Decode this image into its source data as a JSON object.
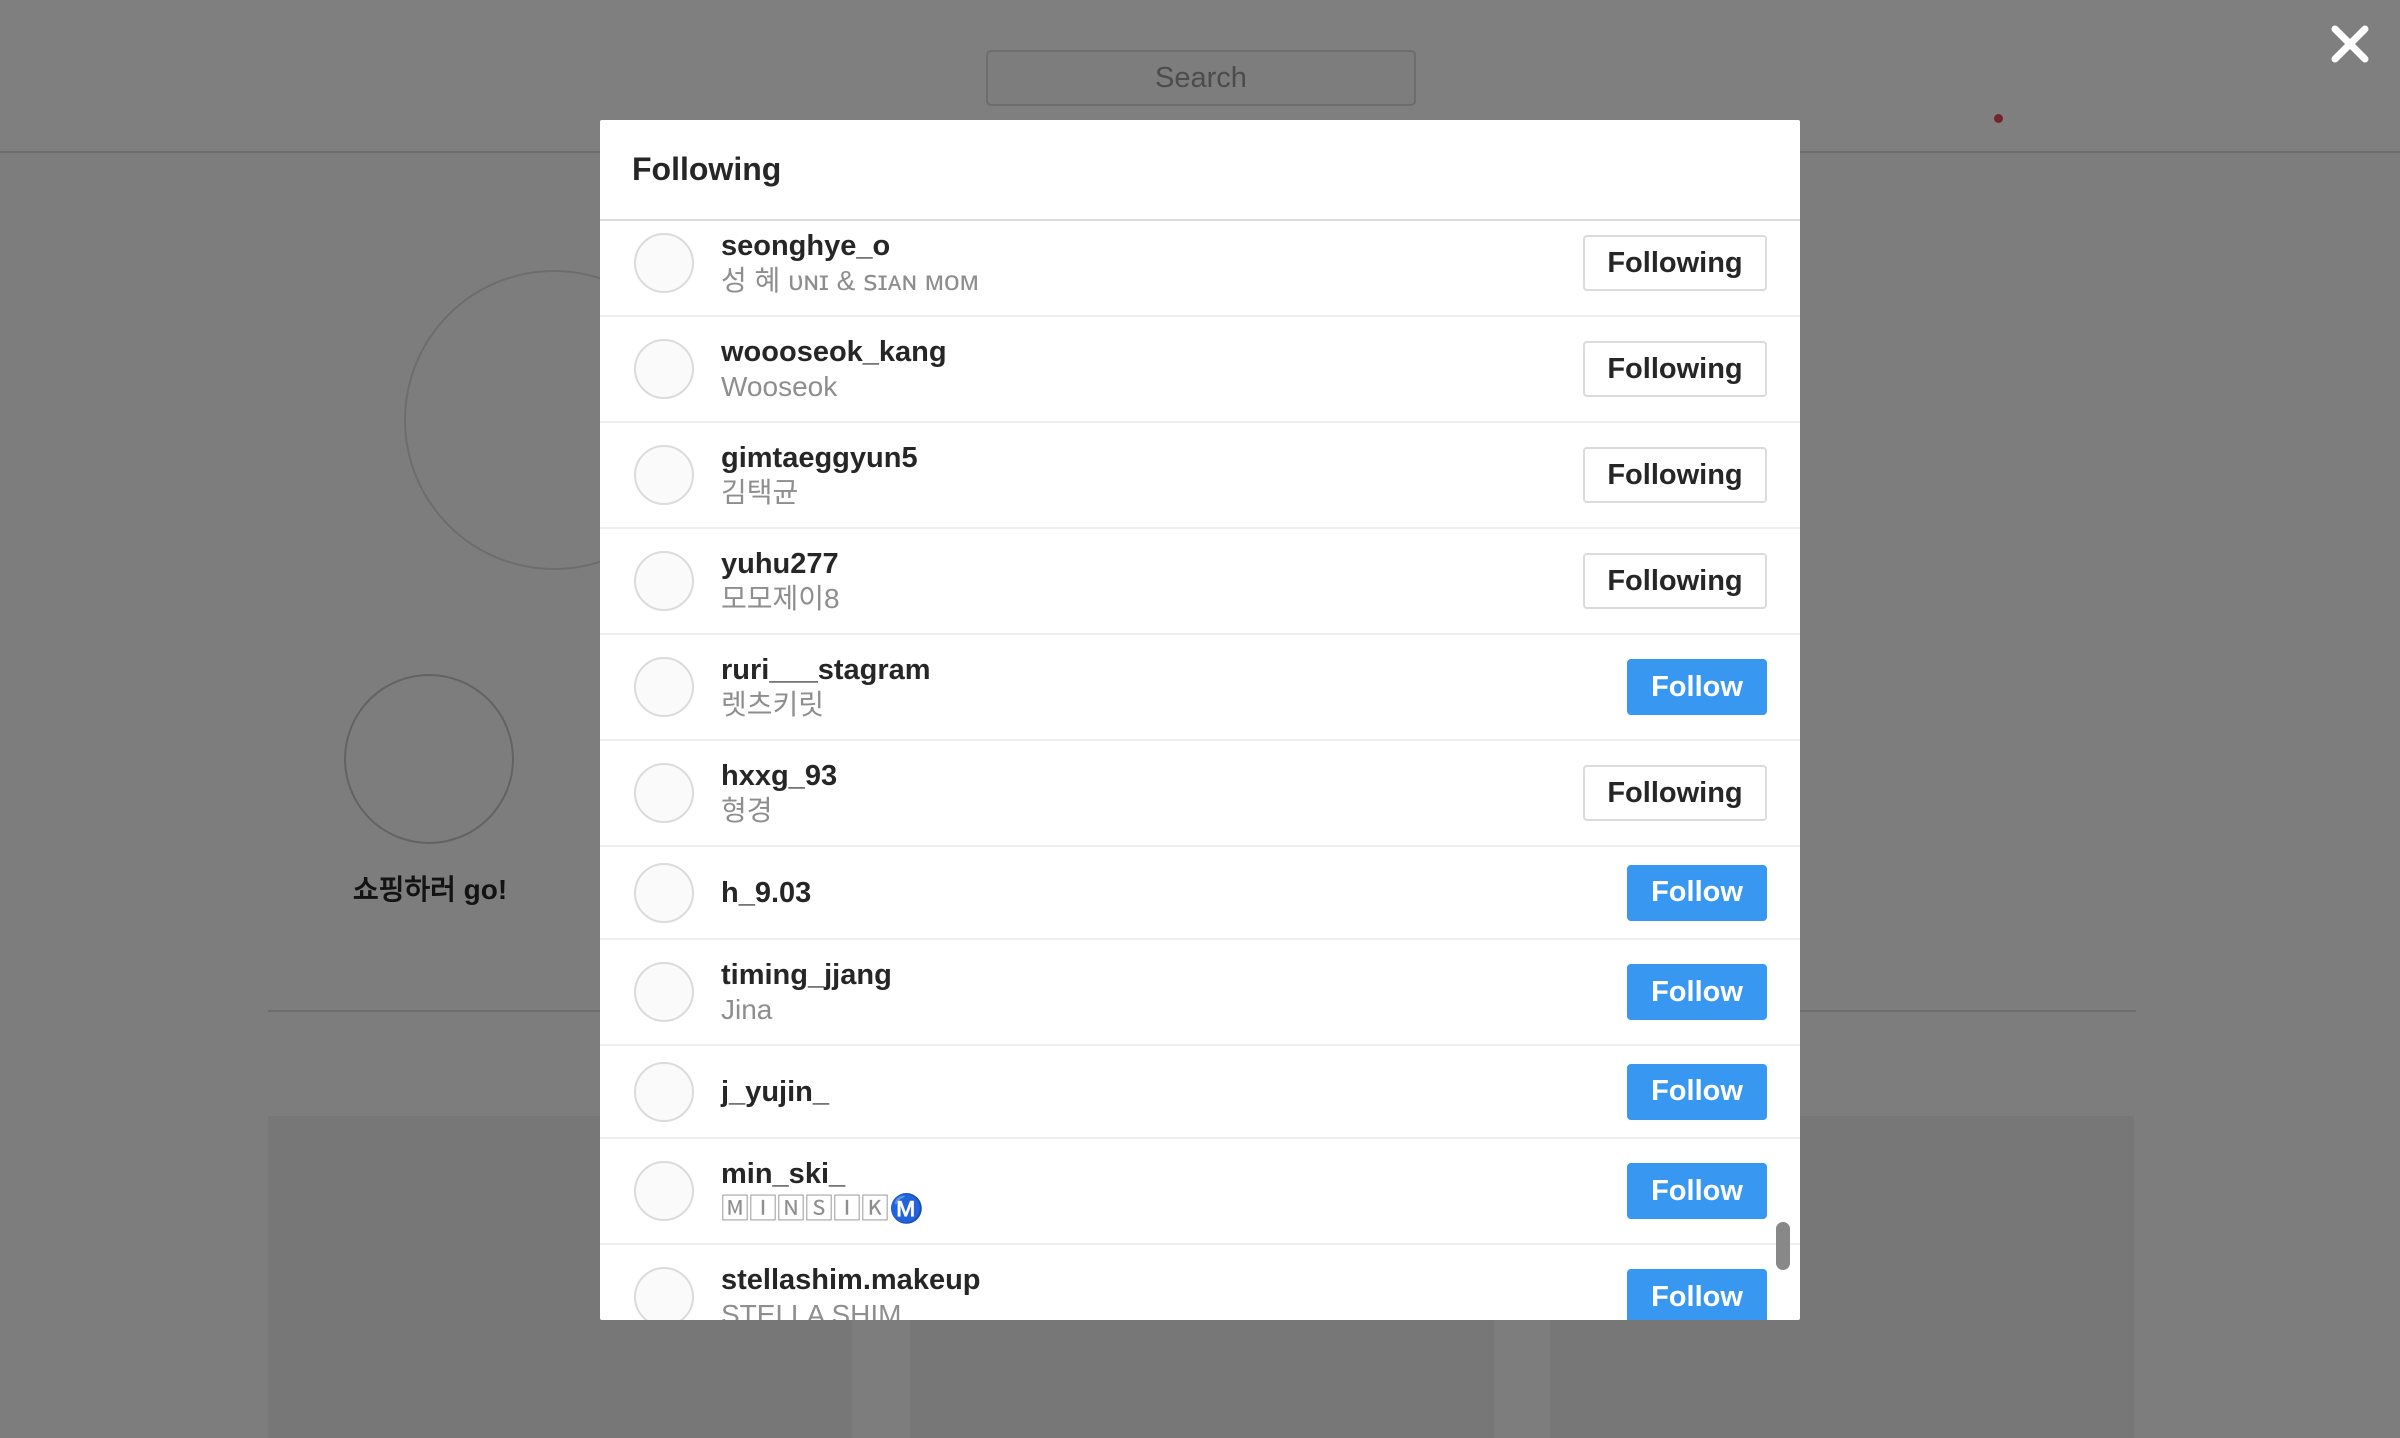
{
  "background": {
    "search_placeholder": "Search",
    "highlight_label": "쇼핑하러 go!"
  },
  "modal": {
    "title": "Following",
    "close_icon": "close-icon",
    "users": [
      {
        "username": "seonghye_o",
        "fullname": "성 혜 ᴜɴɪ & ꜱɪᴀɴ ᴍᴏᴍ",
        "button": "Following",
        "following": true
      },
      {
        "username": "woooseok_kang",
        "fullname": "Wooseok",
        "button": "Following",
        "following": true
      },
      {
        "username": "gimtaeggyun5",
        "fullname": "김택균",
        "button": "Following",
        "following": true
      },
      {
        "username": "yuhu277",
        "fullname": "모모제이8",
        "button": "Following",
        "following": true
      },
      {
        "username": "ruri___stagram",
        "fullname": "렛츠키릿",
        "button": "Follow",
        "following": false
      },
      {
        "username": "hxxg_93",
        "fullname": "형경",
        "button": "Following",
        "following": true
      },
      {
        "username": "h_9.03",
        "fullname": "",
        "button": "Follow",
        "following": false
      },
      {
        "username": "timing_jjang",
        "fullname": "Jina",
        "button": "Follow",
        "following": false
      },
      {
        "username": "j_yujin_",
        "fullname": "",
        "button": "Follow",
        "following": false
      },
      {
        "username": "min_ski_",
        "fullname": "🄼🄸🄽🅂🄸🄺Ⓜ️",
        "button": "Follow",
        "following": false
      },
      {
        "username": "stellashim.makeup",
        "fullname": "STELLA SHIM",
        "button": "Follow",
        "following": false
      }
    ]
  },
  "colors": {
    "follow_blue": "#3897f0",
    "overlay": "rgba(0,0,0,0.5)"
  }
}
